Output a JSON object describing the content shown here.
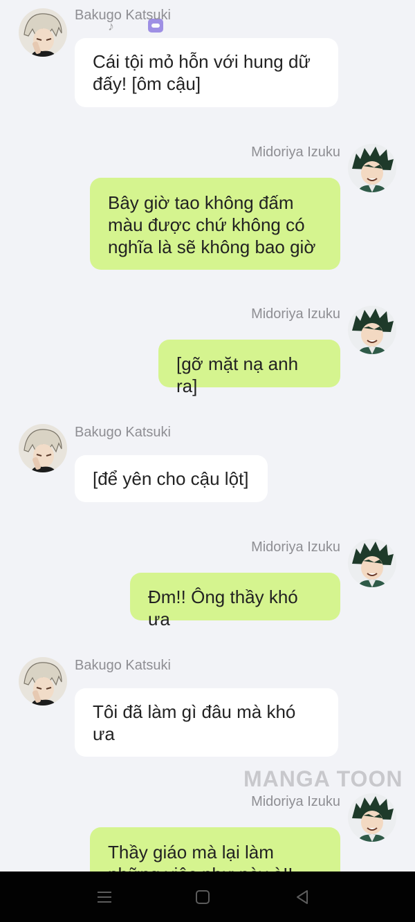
{
  "status_bar": {
    "icons": [
      "tiktok-icon",
      "app-icon"
    ]
  },
  "participants": {
    "left": "Bakugo Katsuki",
    "right": "Midoriya Izuku"
  },
  "messages": [
    {
      "side": "left",
      "sender": "Bakugo Katsuki",
      "lines": [
        "Cái tội mỏ hỗn với hung dữ",
        "đấy! [ôm cậu]"
      ]
    },
    {
      "side": "right",
      "sender": "Midoriya Izuku",
      "lines": [
        "Bây giờ tao không đấm",
        "màu được chứ không có",
        "nghĩa là sẽ không bao giờ"
      ]
    },
    {
      "side": "right",
      "sender": "Midoriya Izuku",
      "lines": [
        "[gỡ mặt nạ anh ra]"
      ]
    },
    {
      "side": "left",
      "sender": "Bakugo Katsuki",
      "lines": [
        "[để yên cho cậu lột]"
      ]
    },
    {
      "side": "right",
      "sender": "Midoriya Izuku",
      "lines": [
        "Đm!! Ông thầy khó ưa"
      ]
    },
    {
      "side": "left",
      "sender": "Bakugo Katsuki",
      "lines": [
        "Tôi đã làm gì đâu mà khó",
        "ưa"
      ]
    },
    {
      "side": "right",
      "sender": "Midoriya Izuku",
      "lines": [
        "Thầy giáo mà lại làm",
        "những việc như này à!! Tôi"
      ]
    }
  ],
  "watermark": "MANGA TOON",
  "nav_bar": {
    "buttons": [
      "menu-icon",
      "home-icon",
      "back-icon"
    ]
  },
  "colors": {
    "background": "#f2f3f7",
    "left_bubble": "#ffffff",
    "right_bubble": "#d5f48f",
    "name_text": "#8e8e93",
    "nav_bar": "#020202"
  }
}
